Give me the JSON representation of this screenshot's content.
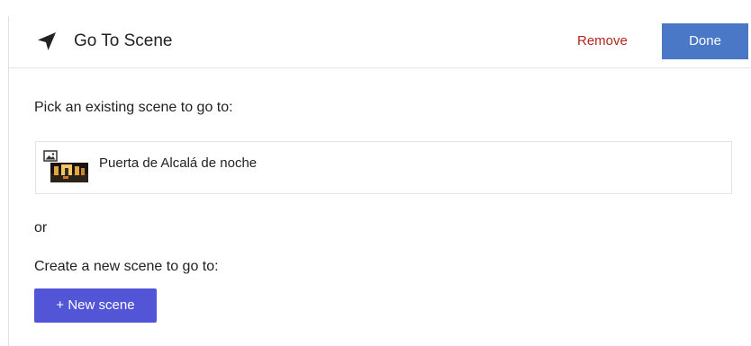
{
  "dialog": {
    "title": "Go To Scene",
    "title_icon": "navigation-arrow-icon",
    "remove_label": "Remove",
    "done_label": "Done"
  },
  "existing": {
    "prompt": "Pick an existing scene to go to:",
    "scenes": [
      {
        "name": "Puerta de Alcalá de noche",
        "thumbnail_icon": "image-placeholder-icon"
      }
    ]
  },
  "separator_text": "or",
  "create": {
    "prompt": "Create a new scene to go to:",
    "button_label": "+ New scene"
  },
  "colors": {
    "done_button": "#4a78c6",
    "remove_link": "#b3261e",
    "new_scene_button": "#5155d6"
  }
}
